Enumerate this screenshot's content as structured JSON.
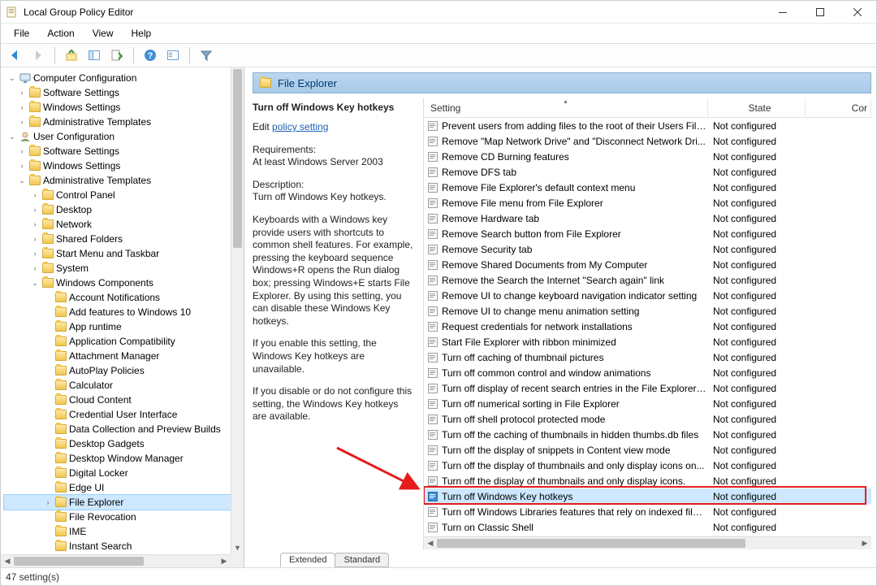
{
  "window": {
    "title": "Local Group Policy Editor"
  },
  "menubar": [
    "File",
    "Action",
    "View",
    "Help"
  ],
  "tree": {
    "root": "Computer Configuration",
    "cc_children": [
      "Software Settings",
      "Windows Settings",
      "Administrative Templates"
    ],
    "uc": "User Configuration",
    "uc_children": [
      "Software Settings",
      "Windows Settings"
    ],
    "admin_templates": "Administrative Templates",
    "at_children": [
      "Control Panel",
      "Desktop",
      "Network",
      "Shared Folders",
      "Start Menu and Taskbar",
      "System"
    ],
    "win_components": "Windows Components",
    "wc_children": [
      "Account Notifications",
      "Add features to Windows 10",
      "App runtime",
      "Application Compatibility",
      "Attachment Manager",
      "AutoPlay Policies",
      "Calculator",
      "Cloud Content",
      "Credential User Interface",
      "Data Collection and Preview Builds",
      "Desktop Gadgets",
      "Desktop Window Manager",
      "Digital Locker",
      "Edge UI",
      "File Explorer",
      "File Revocation",
      "IME",
      "Instant Search"
    ],
    "selected": "File Explorer"
  },
  "fx_header": "File Explorer",
  "info": {
    "title": "Turn off Windows Key hotkeys",
    "edit_prefix": "Edit ",
    "edit_link": "policy setting",
    "req_label": "Requirements:",
    "req_value": "At least Windows Server 2003",
    "desc_label": "Description:",
    "desc_value": "Turn off Windows Key hotkeys.",
    "para1": "Keyboards with a Windows key provide users with shortcuts to common shell features. For example, pressing the keyboard sequence Windows+R opens the Run dialog box; pressing Windows+E starts File Explorer. By using this setting, you can disable these Windows Key hotkeys.",
    "para2": "If you enable this setting, the Windows Key hotkeys are unavailable.",
    "para3": "If you disable or do not configure this setting, the Windows Key hotkeys are available."
  },
  "list": {
    "columns": {
      "setting": "Setting",
      "state": "State",
      "comment": "Comment"
    },
    "comment_trunc": "Cor",
    "rows": [
      "Prevent users from adding files to the root of their Users File...",
      "Remove \"Map Network Drive\" and \"Disconnect Network Dri...",
      "Remove CD Burning features",
      "Remove DFS tab",
      "Remove File Explorer's default context menu",
      "Remove File menu from File Explorer",
      "Remove Hardware tab",
      "Remove Search button from File Explorer",
      "Remove Security tab",
      "Remove Shared Documents from My Computer",
      "Remove the Search the Internet \"Search again\" link",
      "Remove UI to change keyboard navigation indicator setting",
      "Remove UI to change menu animation setting",
      "Request credentials for network installations",
      "Start File Explorer with ribbon minimized",
      "Turn off caching of thumbnail pictures",
      "Turn off common control and window animations",
      "Turn off display of recent search entries in the File Explorer s...",
      "Turn off numerical sorting in File Explorer",
      "Turn off shell protocol protected mode",
      "Turn off the caching of thumbnails in hidden thumbs.db files",
      "Turn off the display of snippets in Content view mode",
      "Turn off the display of thumbnails and only display icons on...",
      "Turn off the display of thumbnails and only display icons.",
      "Turn off Windows Key hotkeys",
      "Turn off Windows Libraries features that rely on indexed file ...",
      "Turn on Classic Shell"
    ],
    "state_value": "Not configured",
    "selected_index": 24
  },
  "tabs": {
    "extended": "Extended",
    "standard": "Standard"
  },
  "statusbar": "47 setting(s)"
}
